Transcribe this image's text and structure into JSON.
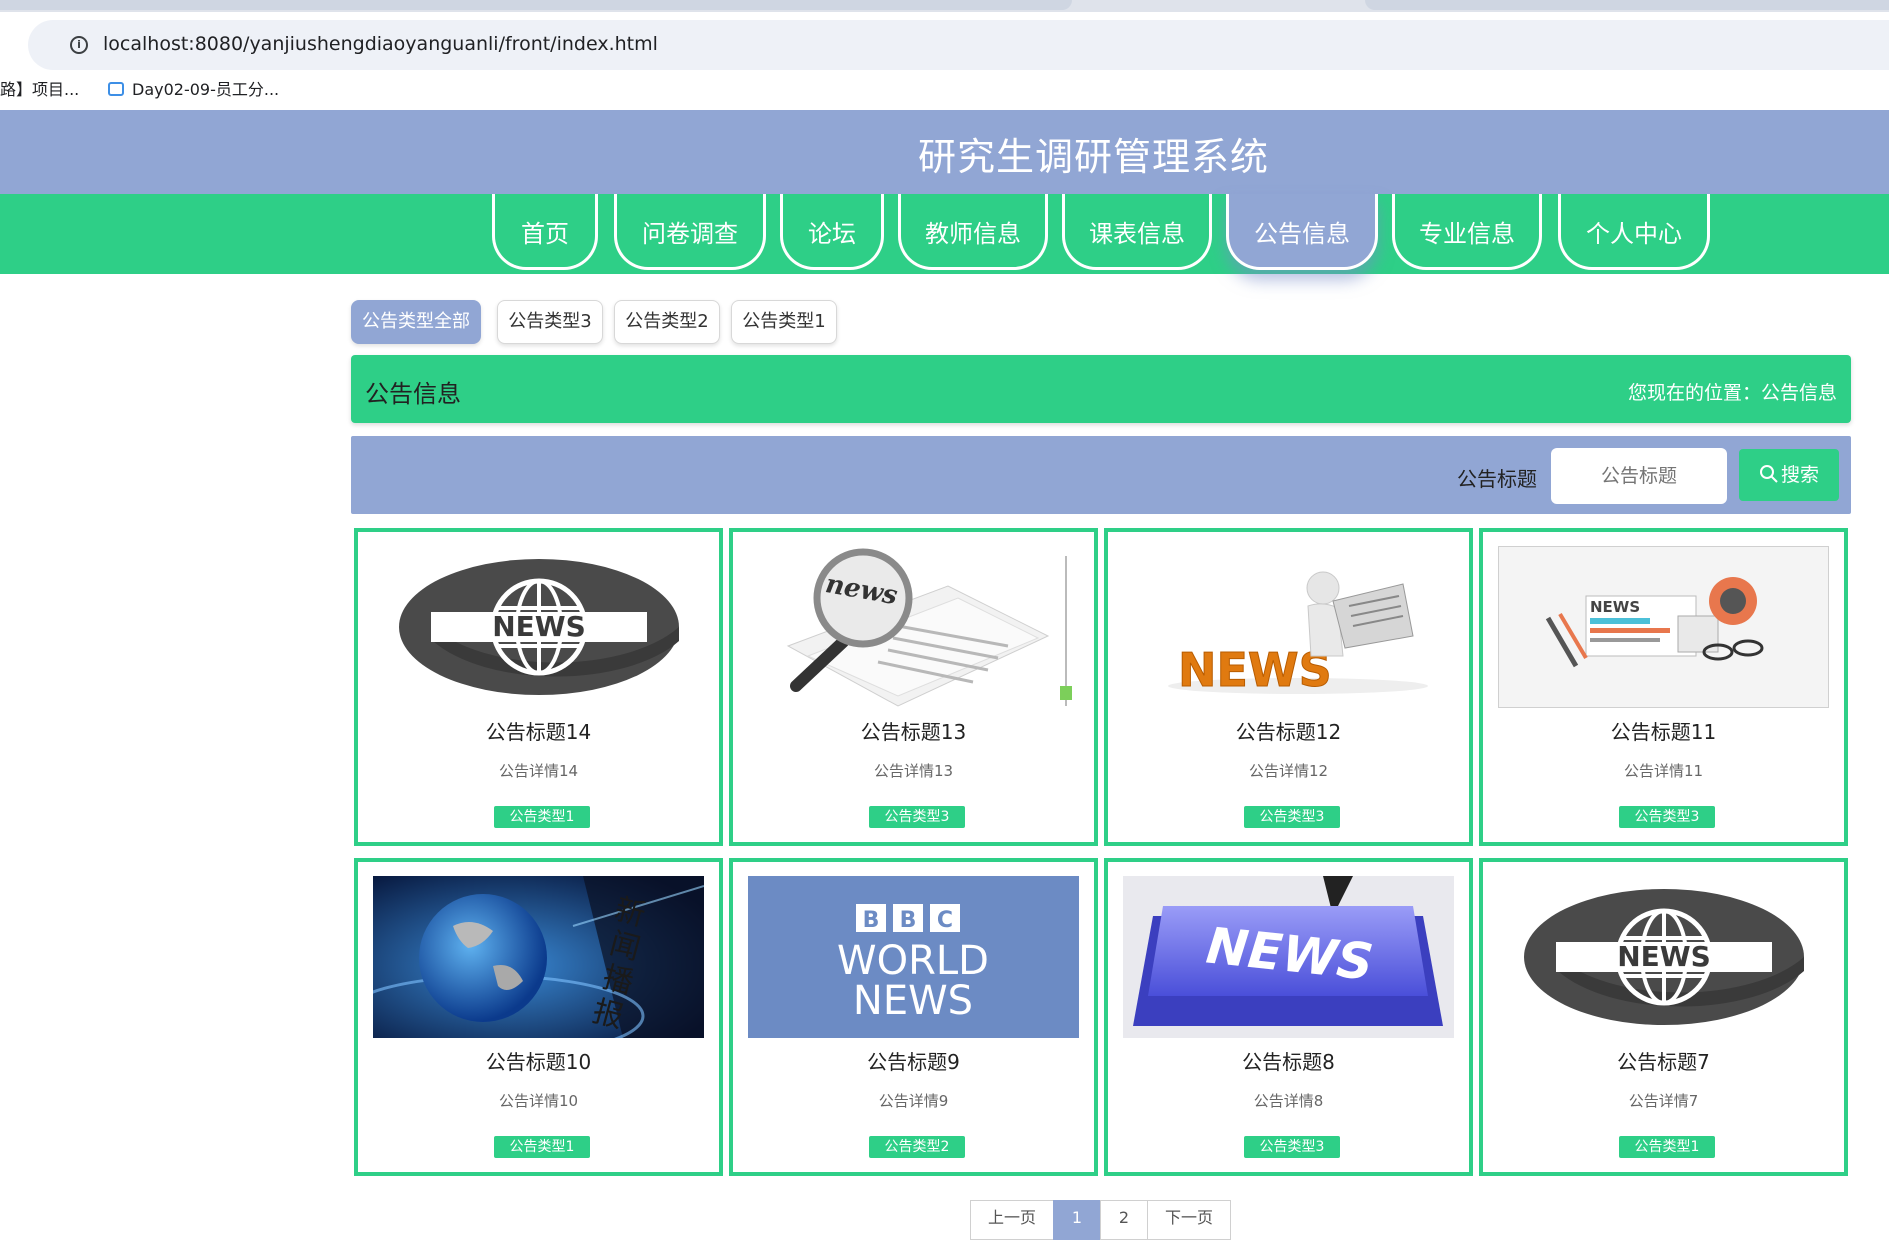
{
  "browser": {
    "url": "localhost:8080/yanjiushengdiaoyanguanli/front/index.html",
    "back_fragment": ")",
    "bookmarks": [
      {
        "label": "路】项目..."
      },
      {
        "label": "Day02-09-员工分..."
      }
    ]
  },
  "site": {
    "title": "研究生调研管理系统"
  },
  "nav": {
    "items": [
      {
        "label": "首页"
      },
      {
        "label": "问卷调查"
      },
      {
        "label": "论坛"
      },
      {
        "label": "教师信息"
      },
      {
        "label": "课表信息"
      },
      {
        "label": "公告信息"
      },
      {
        "label": "专业信息"
      },
      {
        "label": "个人中心"
      }
    ],
    "active": "公告信息"
  },
  "filters": {
    "chips": [
      {
        "label": "公告类型全部"
      },
      {
        "label": "公告类型3"
      },
      {
        "label": "公告类型2"
      },
      {
        "label": "公告类型1"
      }
    ],
    "active": "公告类型全部"
  },
  "page": {
    "title": "公告信息",
    "location": "您现在的位置：公告信息"
  },
  "search": {
    "label": "公告标题",
    "placeholder": "公告标题",
    "button_label": "搜索"
  },
  "cards": [
    {
      "title": "公告标题14",
      "detail": "公告详情14",
      "type": "公告类型1",
      "image": "news-globe-badge"
    },
    {
      "title": "公告标题13",
      "detail": "公告详情13",
      "type": "公告类型3",
      "image": "newspaper-magnifier"
    },
    {
      "title": "公告标题12",
      "detail": "公告详情12",
      "type": "公告类型3",
      "image": "news-figure-reading"
    },
    {
      "title": "公告标题11",
      "detail": "公告详情11",
      "type": "公告类型3",
      "image": "news-flatlay"
    },
    {
      "title": "公告标题10",
      "detail": "公告详情10",
      "type": "公告类型1",
      "image": "broadcast-earth"
    },
    {
      "title": "公告标题9",
      "detail": "公告详情9",
      "type": "公告类型2",
      "image": "bbc-world-news"
    },
    {
      "title": "公告标题8",
      "detail": "公告详情8",
      "type": "公告类型3",
      "image": "news-keyboard-key"
    },
    {
      "title": "公告标题7",
      "detail": "公告详情7",
      "type": "公告类型1",
      "image": "news-globe-badge"
    }
  ],
  "image_text": {
    "news": "NEWS",
    "news_lower": "news",
    "bbc": [
      "B",
      "B",
      "C"
    ],
    "world": "WORLD",
    "broadcast": [
      "新",
      "闻",
      "播",
      "报"
    ]
  },
  "pagination": {
    "pages": [
      "上一页",
      "1",
      "2",
      "下一页"
    ],
    "current": "1"
  },
  "colors": {
    "green": "#2ecf87",
    "periwinkle": "#91a6d4"
  }
}
